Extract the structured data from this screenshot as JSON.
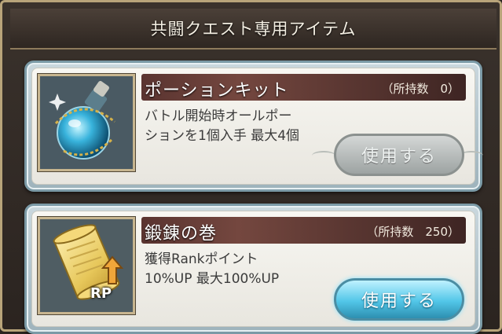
{
  "header": {
    "title": "共闘クエスト専用アイテム"
  },
  "items": [
    {
      "name": "ポーションキット",
      "count": "（所持数　0）",
      "description": "バトル開始時オールポー\nションを1個入手 最大4個",
      "use_label": "使用する",
      "icon": "potion-flask-icon",
      "enabled": false
    },
    {
      "name": "鍛錬の巻",
      "count": "（所持数　250）",
      "description": "獲得Rankポイント\n10%UP 最大100%UP",
      "use_label": "使用する",
      "icon": "scroll-rp-icon",
      "badge": "RP",
      "enabled": true
    }
  ],
  "colors": {
    "name_bar": "#5a3430",
    "button_active": "#52c6e8",
    "button_disabled": "#9da3a2"
  }
}
